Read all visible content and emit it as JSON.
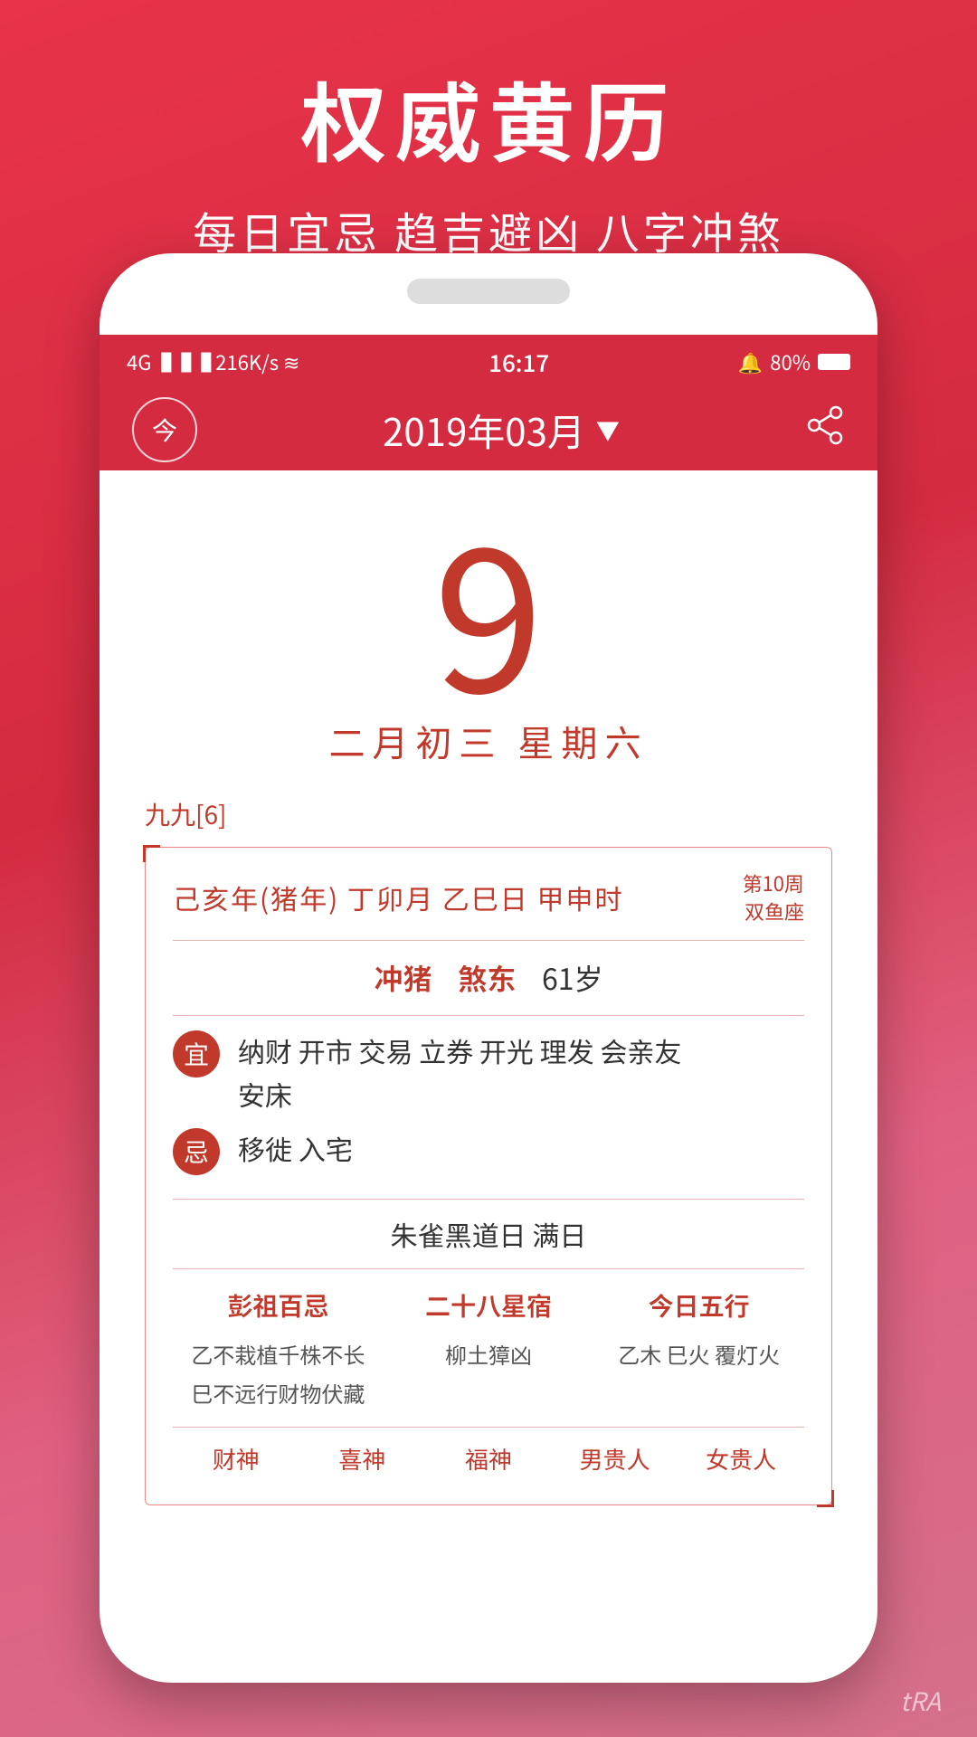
{
  "app": {
    "title": "权威黄历",
    "subtitle": "每日宜忌 趋吉避凶 八字冲煞"
  },
  "status_bar": {
    "signal": "4G ⬛⬛⬛ 216K/s",
    "wifi": "▲▲",
    "time": "16:17",
    "alarm": "🔔",
    "battery": "80%"
  },
  "nav": {
    "today_label": "今",
    "month_title": "2019年03月",
    "arrow": "▼",
    "share_icon": "share"
  },
  "date": {
    "day_number": "9",
    "lunar_date": "二月初三  星期六"
  },
  "calendar_detail": {
    "period": "九九[6]",
    "ganzhi": "己亥年(猪年) 丁卯月 乙巳日 甲申时",
    "week_info": "第10周",
    "zodiac": "双鱼座",
    "chong": "冲猪",
    "sha": "煞东",
    "age": "61岁",
    "yi_label": "宜",
    "yi_content": "纳财 开市 交易 立券 开光 理发 会亲友\n安床",
    "ji_label": "忌",
    "ji_content": "移徙 入宅",
    "special_day": "朱雀黑道日   满日",
    "pengzu_title": "彭祖百忌",
    "pengzu_content": "乙不栽植千株不长\n巳不远行财物伏藏",
    "star28_title": "二十八星宿",
    "star28_content": "柳土獐凶",
    "wuxing_title": "今日五行",
    "wuxing_content": "乙木 巳火 覆灯火",
    "footer": {
      "label1": "财神",
      "label2": "喜神",
      "label3": "福神",
      "label4": "男贵人",
      "label5": "女贵人"
    }
  },
  "watermark": "tRA"
}
